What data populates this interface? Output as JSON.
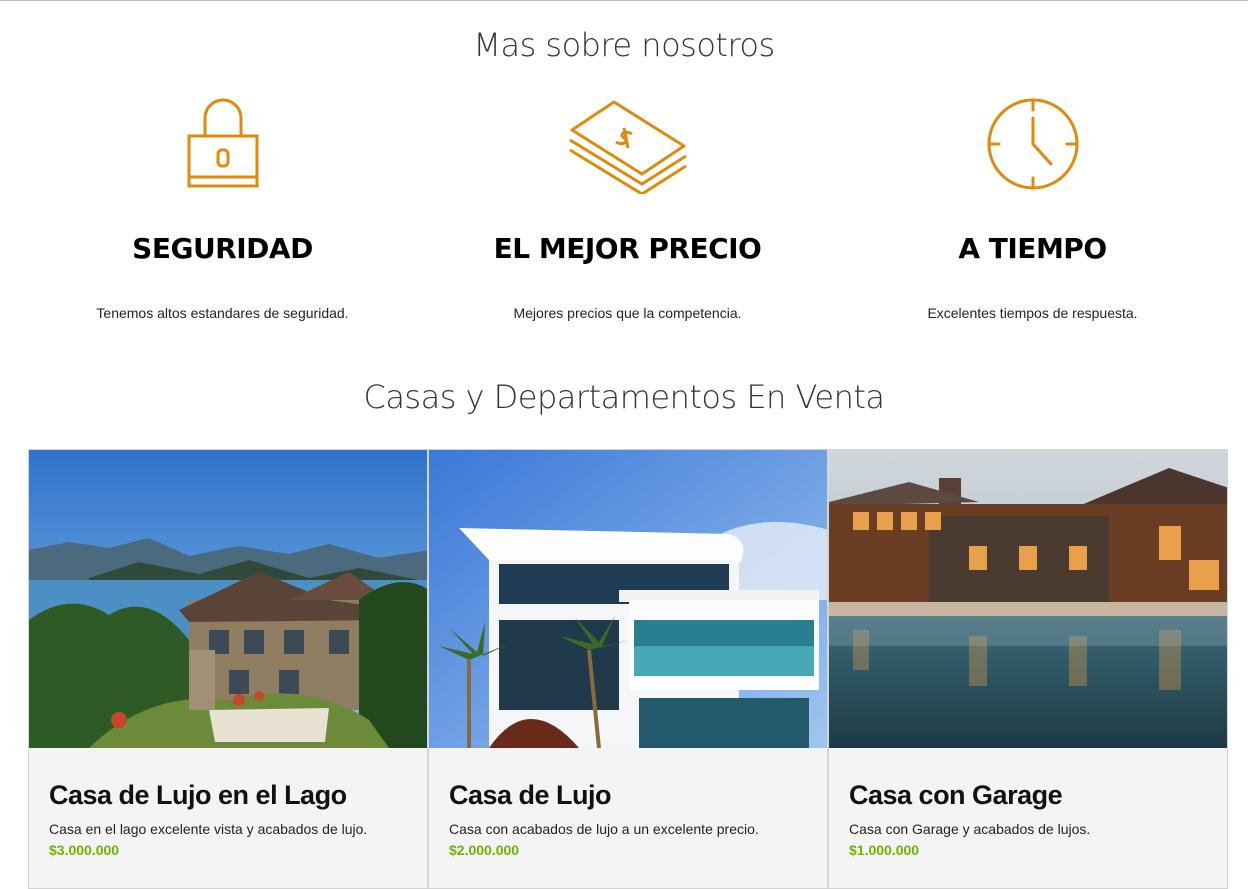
{
  "about": {
    "title": "Mas sobre nosotros",
    "features": [
      {
        "icon": "lock-icon",
        "title": "SEGURIDAD",
        "text": "Tenemos altos estandares de seguridad."
      },
      {
        "icon": "money-stack-icon",
        "title": "EL MEJOR PRECIO",
        "text": "Mejores precios que la competencia."
      },
      {
        "icon": "clock-icon",
        "title": "A TIEMPO",
        "text": "Excelentes tiempos de respuesta."
      }
    ],
    "accent_color": "#e08a0a"
  },
  "listings": {
    "title": "Casas y Departamentos En Venta",
    "price_color": "#71b100",
    "items": [
      {
        "image": "lake-house-photo",
        "title": "Casa de Lujo en el Lago",
        "description": "Casa en el lago excelente vista y acabados de lujo.",
        "price": "$3.000.000"
      },
      {
        "image": "modern-house-photo",
        "title": "Casa de Lujo",
        "description": "Casa con acabados de lujo a un excelente precio.",
        "price": "$2.000.000"
      },
      {
        "image": "pool-house-photo",
        "title": "Casa con Garage",
        "description": "Casa con Garage y acabados de lujos.",
        "price": "$1.000.000"
      }
    ]
  }
}
